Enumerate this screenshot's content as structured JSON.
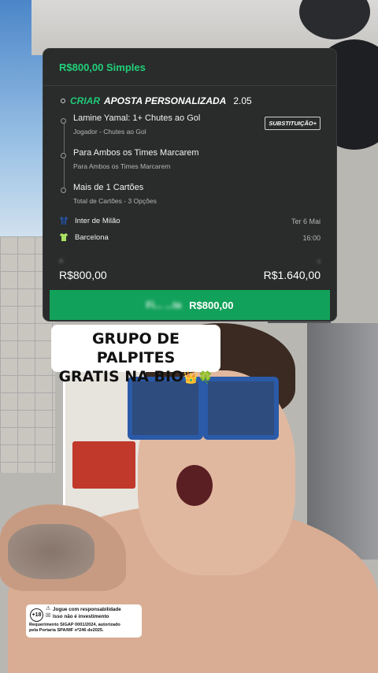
{
  "bet_slip": {
    "header": "R$800,00  Simples",
    "custom_bet": {
      "word1": "CRIAR",
      "word2": "APOSTA PERSONALIZADA",
      "odds": "2.05"
    },
    "substitution_label": "SUBSTITUIÇÃO+",
    "legs": [
      {
        "title": "Lamine Yamal: 1+ Chutes ao Gol",
        "subtitle": "Jogador - Chutes ao Gol"
      },
      {
        "title": "Para Ambos os Times Marcarem",
        "subtitle": "Para Ambos os Times Marcarem"
      },
      {
        "title": "Mais de 1 Cartões",
        "subtitle": "Total de Cartões - 3 Opções"
      }
    ],
    "teams": [
      {
        "name": "Inter de Milão",
        "shirt_color": "#2a5aa8"
      },
      {
        "name": "Barcelona",
        "shirt_color": "#a8e063"
      }
    ],
    "date": "Ter 6 Mai",
    "time": "16:00",
    "stake_label": "A",
    "return_label": "s",
    "stake": "R$800,00",
    "potential_return": "R$1.640,00",
    "cta_label_blurred": "Fi... ...ta",
    "cta_amount": "R$800,00",
    "accent": "#22d17a"
  },
  "promo": {
    "line1": "GRUPO DE PALPITES",
    "line2": "GRATIS NA BIO",
    "emoji": "👑🍀"
  },
  "notice": {
    "age": "+18",
    "line1": "Jogue com responsabilidade",
    "line2": "Isso não é investimento",
    "footer1": "Requerimento SIGAP 0001/2024, autorizado",
    "footer2": "pela Portaria SPA/MF nº246 de2025."
  }
}
